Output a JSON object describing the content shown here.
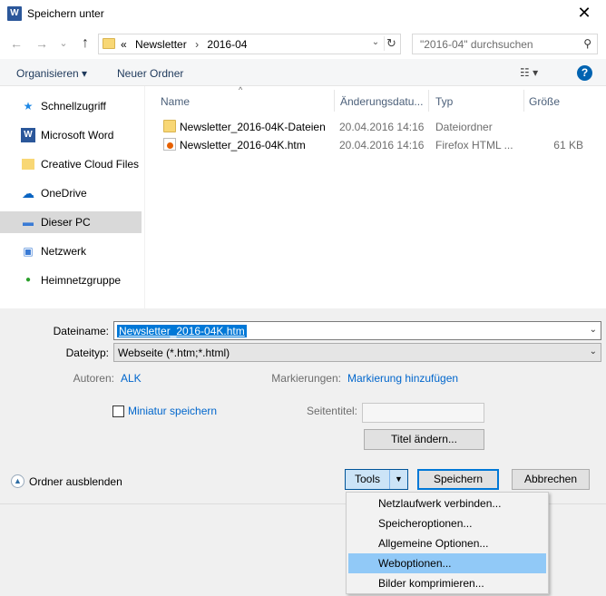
{
  "window": {
    "title": "Speichern unter",
    "close": "✕",
    "app_icon": "W"
  },
  "nav": {
    "back": "←",
    "forward": "→",
    "recent": "⌄",
    "up": "↑",
    "address": {
      "overflow": "«",
      "crumbs": [
        "Newsletter",
        "2016-04"
      ],
      "separator": "›"
    },
    "search_placeholder": "\"2016-04\" durchsuchen"
  },
  "toolbar": {
    "organize": "Organisieren ▾",
    "new_folder": "Neuer Ordner",
    "help": "?"
  },
  "sidebar": {
    "items": [
      {
        "label": "Schnellzugriff",
        "icon": "★"
      },
      {
        "label": "Microsoft Word",
        "icon": "W"
      },
      {
        "label": "Creative Cloud Files",
        "icon": "▭"
      },
      {
        "label": "OneDrive",
        "icon": "☁"
      },
      {
        "label": "Dieser PC",
        "icon": "▬"
      },
      {
        "label": "Netzwerk",
        "icon": "▣"
      },
      {
        "label": "Heimnetzgruppe",
        "icon": "●"
      }
    ],
    "selected": "Dieser PC"
  },
  "files": {
    "columns": [
      "Name",
      "Änderungsdatu...",
      "Typ",
      "Größe"
    ],
    "rows": [
      {
        "name": "Newsletter_2016-04K-Dateien",
        "date": "20.04.2016 14:16",
        "type": "Dateiordner",
        "size": "",
        "kind": "folder"
      },
      {
        "name": "Newsletter_2016-04K.htm",
        "date": "20.04.2016 14:16",
        "type": "Firefox HTML ...",
        "size": "61 KB",
        "kind": "htm"
      }
    ]
  },
  "form": {
    "filename_label": "Dateiname:",
    "filename_value": "Newsletter_2016-04K.htm",
    "filetype_label": "Dateityp:",
    "filetype_value": "Webseite (*.htm;*.html)",
    "authors_label": "Autoren:",
    "authors_value": "ALK",
    "tags_label": "Markierungen:",
    "tags_value": "Markierung hinzufügen",
    "thumbnail_label": "Miniatur speichern",
    "page_title_label": "Seitentitel:",
    "change_title_button": "Titel ändern...",
    "hide_folders": "Ordner ausblenden",
    "tools_button": "Tools",
    "save_button": "Speichern",
    "cancel_button": "Abbrechen"
  },
  "tools_menu": {
    "items": [
      "Netzlaufwerk verbinden...",
      "Speicheroptionen...",
      "Allgemeine Optionen...",
      "Weboptionen...",
      "Bilder komprimieren..."
    ],
    "highlighted": "Weboptionen..."
  },
  "colors": {
    "accent": "#0078d7",
    "link": "#0066cc",
    "menu_highlight": "#91c9f7",
    "help": "#0063b1"
  }
}
